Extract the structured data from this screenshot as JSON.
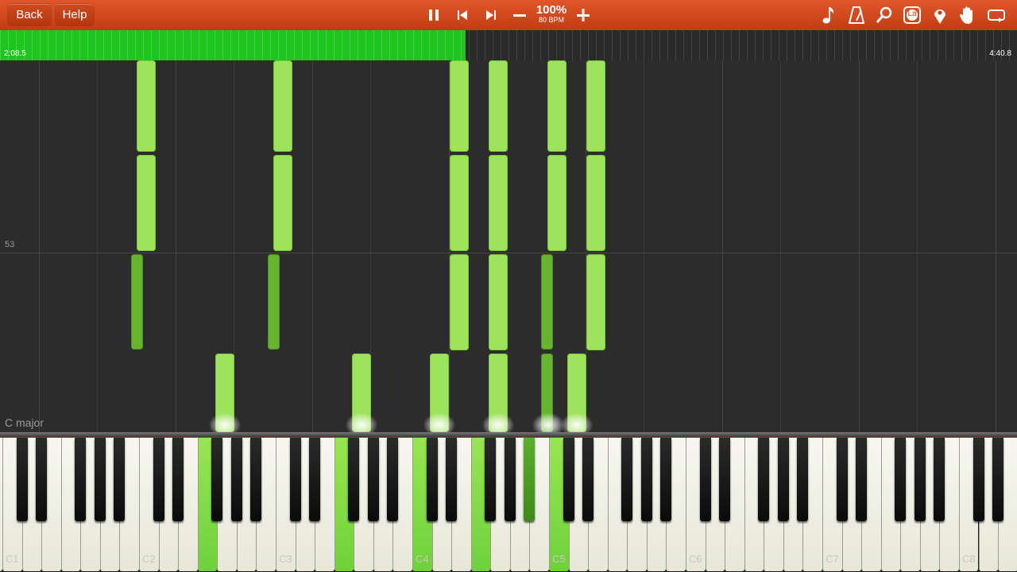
{
  "toolbar": {
    "back_label": "Back",
    "help_label": "Help",
    "speed_percent": "100%",
    "tempo": "80 BPM",
    "tempo_icon_text": "La"
  },
  "progress": {
    "current_time": "2:08.5",
    "total_time": "4:40.8",
    "fraction": 0.458
  },
  "roll": {
    "measure_number": "53",
    "key_signature": "C major"
  },
  "keyboard": {
    "octave_labels": [
      "C1",
      "C2",
      "C3",
      "C4",
      "C5",
      "C6",
      "C7",
      "C8"
    ]
  },
  "colors": {
    "toolbar": "#d2491f",
    "progress_fill": "#1ec51e",
    "note_light": "#9ee35c",
    "note_dark": "#67b52f"
  }
}
